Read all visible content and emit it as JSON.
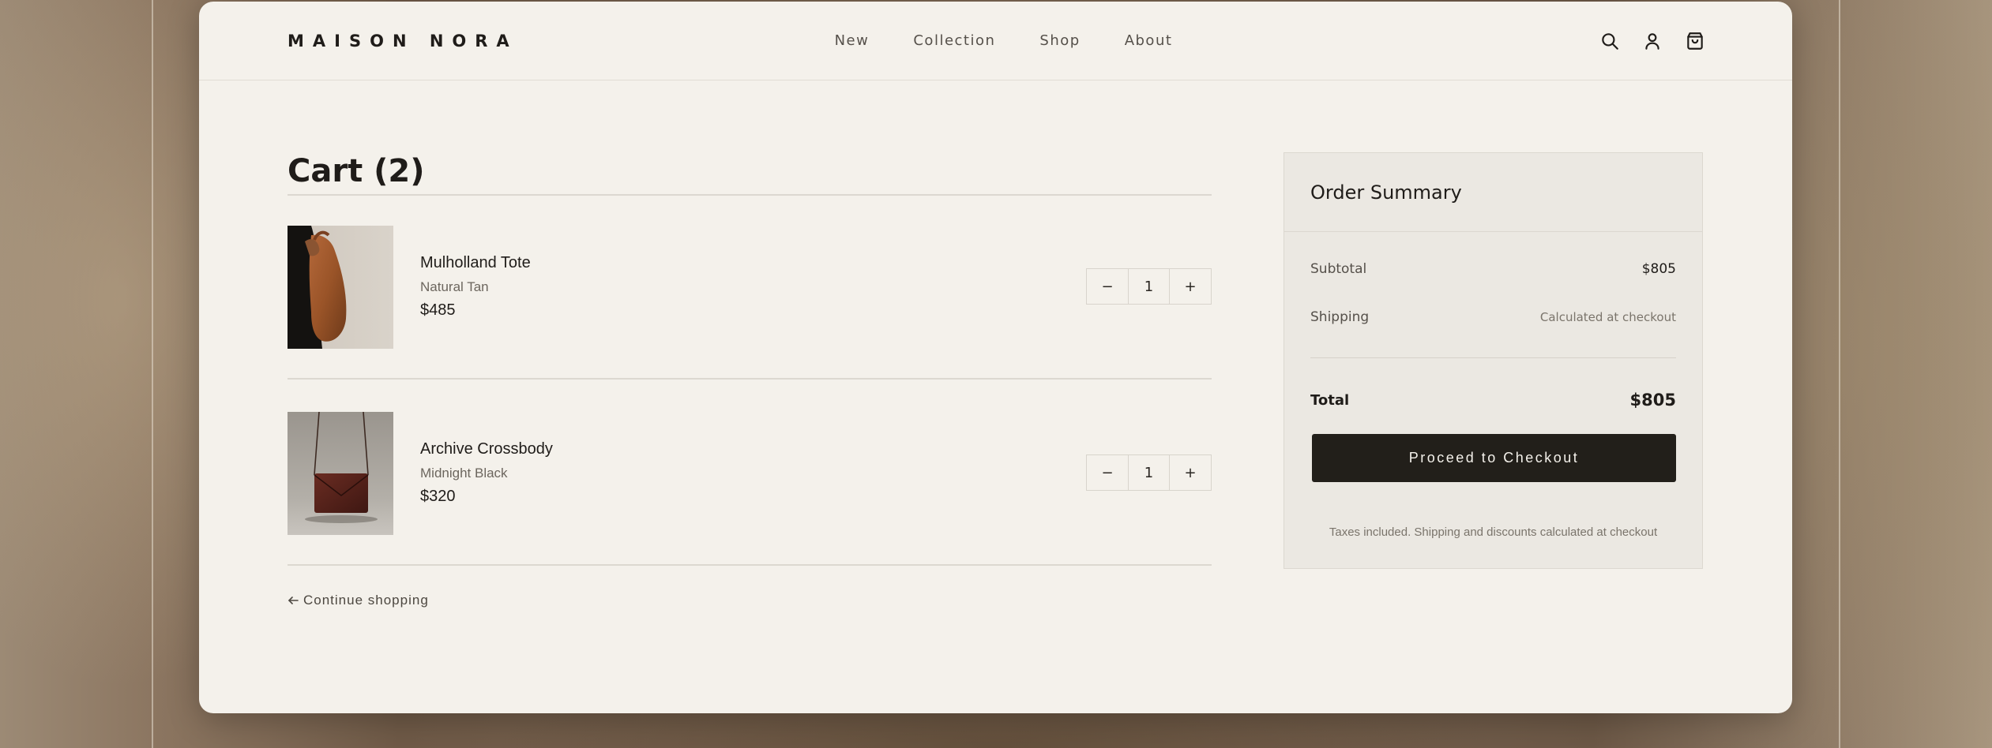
{
  "brand": {
    "logo": "MAISON NORA"
  },
  "nav": {
    "items": [
      "New",
      "Collection",
      "Shop",
      "About"
    ]
  },
  "header_icons": [
    "search-icon",
    "account-icon",
    "shopping-bag-icon"
  ],
  "cart": {
    "title": "Cart (2)",
    "items": [
      {
        "name": "Mulholland Tote",
        "variant": "Natural Tan",
        "price": "$485",
        "quantity": "1",
        "decrement": "−",
        "increment": "+"
      },
      {
        "name": "Archive Crossbody",
        "variant": "Midnight Black",
        "price": "$320",
        "quantity": "1",
        "decrement": "−",
        "increment": "+"
      }
    ],
    "continue_label": "Continue shopping"
  },
  "summary": {
    "title": "Order Summary",
    "subtotal_label": "Subtotal",
    "subtotal_value": "$805",
    "shipping_label": "Shipping",
    "shipping_value": "Calculated at checkout",
    "total_label": "Total",
    "total_value": "$805",
    "checkout_label": "Proceed to Checkout",
    "note": "Taxes included. Shipping and discounts calculated at checkout"
  },
  "colors": {
    "page_bg": "#f4f1eb",
    "summary_bg": "#ebe8e2",
    "button_bg": "#221f1a",
    "text": "#1f1c19"
  }
}
